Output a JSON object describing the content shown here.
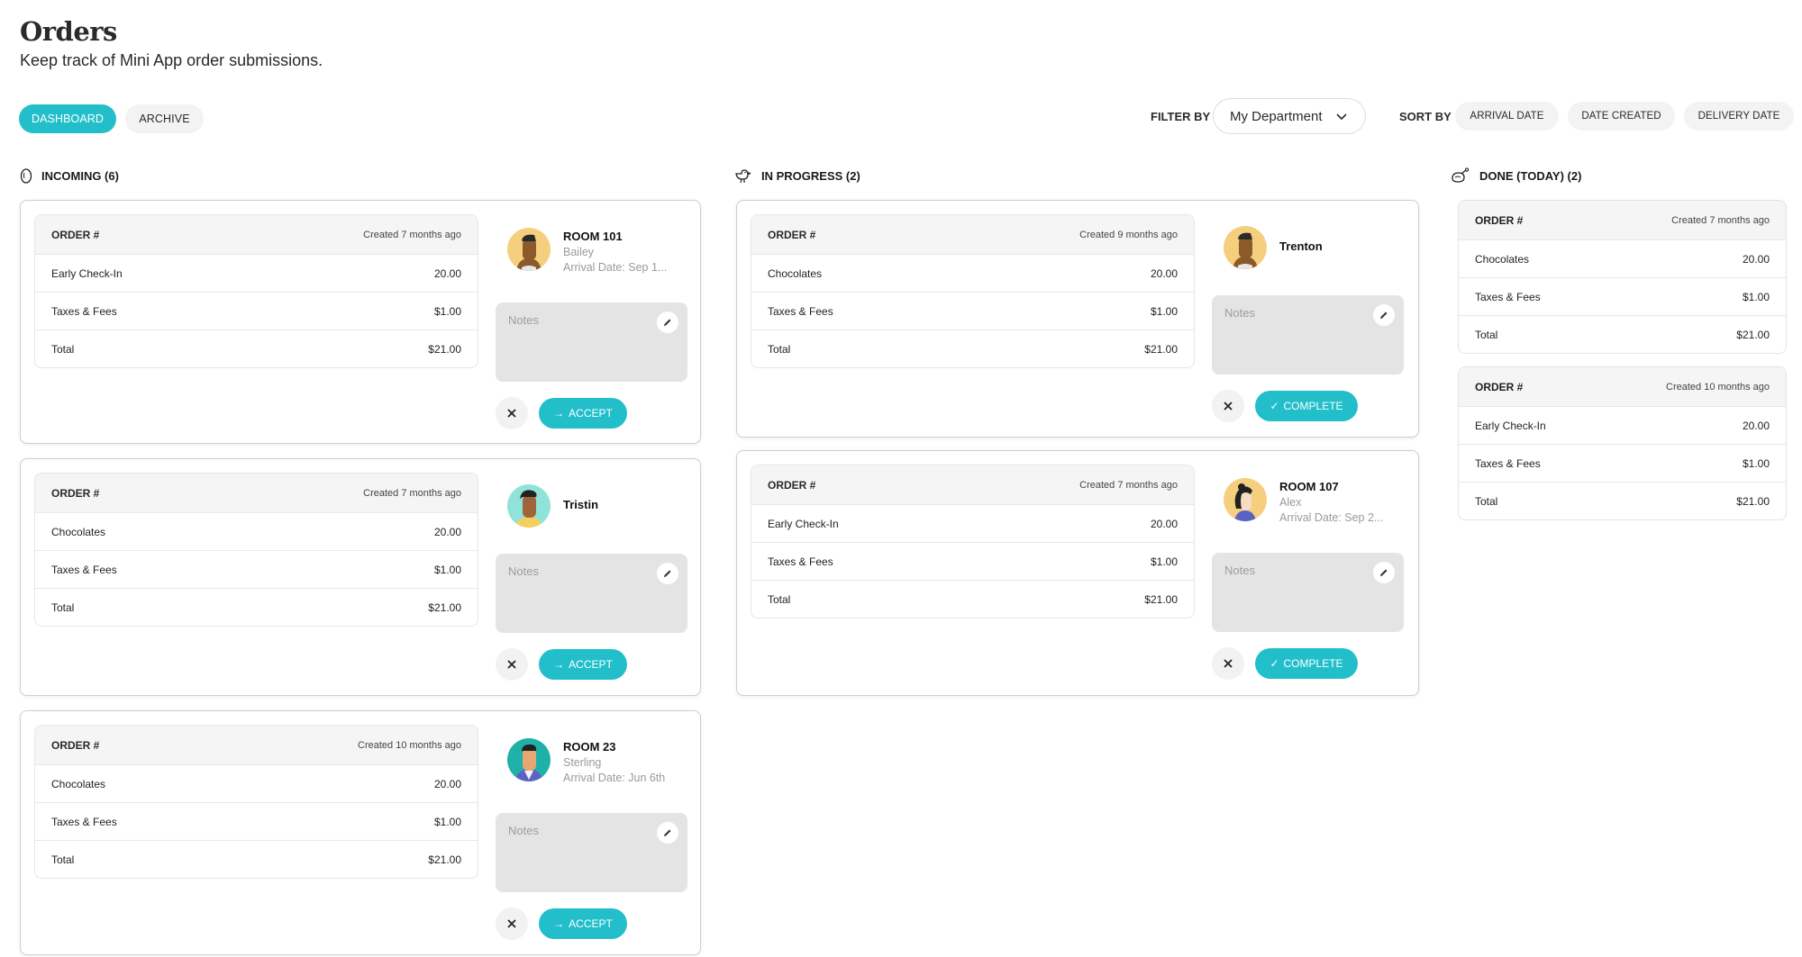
{
  "header": {
    "title": "Orders",
    "subtitle": "Keep track of Mini App order submissions."
  },
  "tabs": [
    {
      "label": "DASHBOARD",
      "active": true
    },
    {
      "label": "ARCHIVE",
      "active": false
    }
  ],
  "filter": {
    "label": "FILTER BY",
    "value": "My Department"
  },
  "sort": {
    "label": "SORT BY",
    "options": [
      "ARRIVAL DATE",
      "DATE CREATED",
      "DELIVERY DATE"
    ]
  },
  "accent_color": "#22bfcb",
  "columns": {
    "incoming": {
      "title": "INCOMING (6)",
      "icon": "egg-icon",
      "cards": [
        {
          "order_label": "ORDER #",
          "created": "Created 7 months ago",
          "items": [
            {
              "name": "Early Check-In",
              "value": "20.00"
            },
            {
              "name": "Taxes & Fees",
              "value": "$1.00"
            },
            {
              "name": "Total",
              "value": "$21.00"
            }
          ],
          "room": "ROOM 101",
          "guest": "Bailey",
          "arrival": "Arrival Date: Sep 1...",
          "notes_placeholder": "Notes",
          "action": "ACCEPT"
        },
        {
          "order_label": "ORDER #",
          "created": "Created 7 months ago",
          "items": [
            {
              "name": "Chocolates",
              "value": "20.00"
            },
            {
              "name": "Taxes & Fees",
              "value": "$1.00"
            },
            {
              "name": "Total",
              "value": "$21.00"
            }
          ],
          "guest": "Tristin",
          "notes_placeholder": "Notes",
          "action": "ACCEPT"
        },
        {
          "order_label": "ORDER #",
          "created": "Created 10 months ago",
          "items": [
            {
              "name": "Chocolates",
              "value": "20.00"
            },
            {
              "name": "Taxes & Fees",
              "value": "$1.00"
            },
            {
              "name": "Total",
              "value": "$21.00"
            }
          ],
          "room": "ROOM 23",
          "guest": "Sterling",
          "arrival": "Arrival Date: Jun 6th",
          "notes_placeholder": "Notes",
          "action": "ACCEPT"
        }
      ]
    },
    "in_progress": {
      "title": "IN PROGRESS (2)",
      "icon": "chick-icon",
      "cards": [
        {
          "order_label": "ORDER #",
          "created": "Created 9 months ago",
          "items": [
            {
              "name": "Chocolates",
              "value": "20.00"
            },
            {
              "name": "Taxes & Fees",
              "value": "$1.00"
            },
            {
              "name": "Total",
              "value": "$21.00"
            }
          ],
          "guest": "Trenton",
          "notes_placeholder": "Notes",
          "action": "COMPLETE"
        },
        {
          "order_label": "ORDER #",
          "created": "Created 7 months ago",
          "items": [
            {
              "name": "Early Check-In",
              "value": "20.00"
            },
            {
              "name": "Taxes & Fees",
              "value": "$1.00"
            },
            {
              "name": "Total",
              "value": "$21.00"
            }
          ],
          "room": "ROOM 107",
          "guest": "Alex",
          "arrival": "Arrival Date: Sep 2...",
          "notes_placeholder": "Notes",
          "action": "COMPLETE"
        }
      ]
    },
    "done": {
      "title": "DONE (TODAY) (2)",
      "icon": "roast-chicken-icon",
      "cards": [
        {
          "order_label": "ORDER #",
          "created": "Created 7 months ago",
          "items": [
            {
              "name": "Chocolates",
              "value": "20.00"
            },
            {
              "name": "Taxes & Fees",
              "value": "$1.00"
            },
            {
              "name": "Total",
              "value": "$21.00"
            }
          ]
        },
        {
          "order_label": "ORDER #",
          "created": "Created 10 months ago",
          "items": [
            {
              "name": "Early Check-In",
              "value": "20.00"
            },
            {
              "name": "Taxes & Fees",
              "value": "$1.00"
            },
            {
              "name": "Total",
              "value": "$21.00"
            }
          ]
        }
      ]
    }
  }
}
